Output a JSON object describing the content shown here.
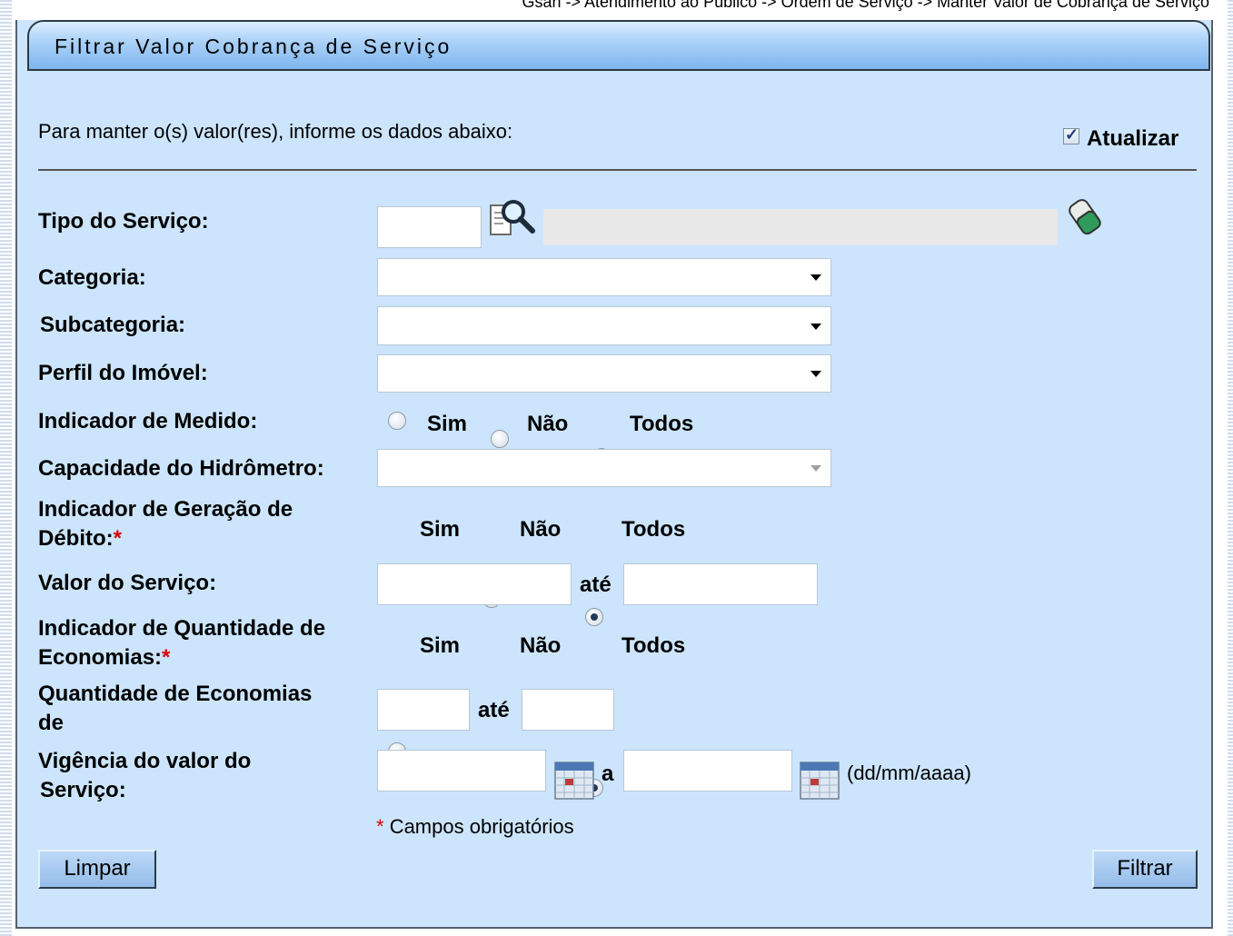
{
  "breadcrumb": "Gsan -> Atendimento ao Público -> Ordem de Serviço -> Manter Valor de Cobrança de Serviço",
  "panel_title": "Filtrar Valor Cobrança de Serviço",
  "intro_text": "Para manter o(s) valor(res), informe os dados abaixo:",
  "atualizar": {
    "label": "Atualizar",
    "checked": true
  },
  "fields": {
    "tipo_servico": {
      "label": "Tipo do Serviço:",
      "code": "",
      "description": ""
    },
    "categoria": {
      "label": "Categoria:",
      "selected": ""
    },
    "subcategoria": {
      "label": "Subcategoria:",
      "selected": ""
    },
    "perfil_imovel": {
      "label": "Perfil do Imóvel:",
      "selected": ""
    },
    "indicador_medido": {
      "label": "Indicador de Medido:",
      "options": [
        "Sim",
        "Não",
        "Todos"
      ],
      "selected": "Todos"
    },
    "capacidade_hidrometro": {
      "label": "Capacidade do Hidrômetro:",
      "selected": "",
      "disabled": true
    },
    "indicador_geracao_debito": {
      "label_line1": "Indicador de Geração de",
      "label_line2": "Débito:",
      "required_mark": "*",
      "options": [
        "Sim",
        "Não",
        "Todos"
      ],
      "selected": "Todos"
    },
    "valor_servico": {
      "label": "Valor do Serviço:",
      "from": "",
      "to": "",
      "range_word": "até"
    },
    "indicador_qtd_economias": {
      "label_line1": "Indicador de Quantidade de",
      "label_line2": "Economias:",
      "required_mark": "*",
      "options": [
        "Sim",
        "Não",
        "Todos"
      ],
      "selected": "Todos"
    },
    "qtd_economias": {
      "label_line1": "Quantidade de Economias",
      "label_line2": "de",
      "from": "",
      "to": "",
      "range_word": "até"
    },
    "vigencia": {
      "label_line1": "Vigência do valor do",
      "label_line2": "Serviço:",
      "from": "",
      "to": "",
      "range_word": "a",
      "format_hint": "(dd/mm/aaaa)"
    }
  },
  "required_note": {
    "mark": "*",
    "text": "Campos obrigatórios"
  },
  "buttons": {
    "limpar": "Limpar",
    "filtrar": "Filtrar"
  },
  "icons": [
    "magnifier-icon",
    "eraser-icon",
    "calendar-icon",
    "checkbox-check-icon"
  ]
}
